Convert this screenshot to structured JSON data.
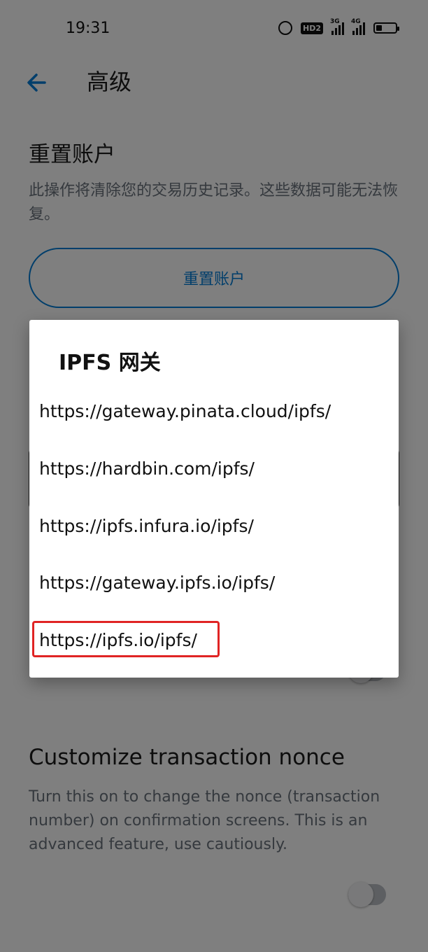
{
  "status_bar": {
    "time": "19:31",
    "hd": "HD2",
    "net1": "3G",
    "net2": "4G"
  },
  "header": {
    "title": "高级"
  },
  "reset_section": {
    "title": "重置账户",
    "description": "此操作将清除您的交易历史记录。这些数据可能无法恢复。",
    "button_label": "重置账户"
  },
  "nonce_section": {
    "title": "Customize transaction nonce",
    "description": "Turn this on to change the nonce (transaction number) on confirmation screens. This is an advanced feature, use cautiously."
  },
  "dialog": {
    "title": "IPFS 网关",
    "options": [
      "https://gateway.pinata.cloud/ipfs/",
      "https://hardbin.com/ipfs/",
      "https://ipfs.infura.io/ipfs/",
      "https://gateway.ipfs.io/ipfs/",
      "https://ipfs.io/ipfs/"
    ],
    "highlighted_option": "https://ipfs.io/ipfs/"
  },
  "colors": {
    "accent": "#037dd6",
    "highlight": "#e02424",
    "scrim": "rgba(0,0,0,0.5)"
  }
}
